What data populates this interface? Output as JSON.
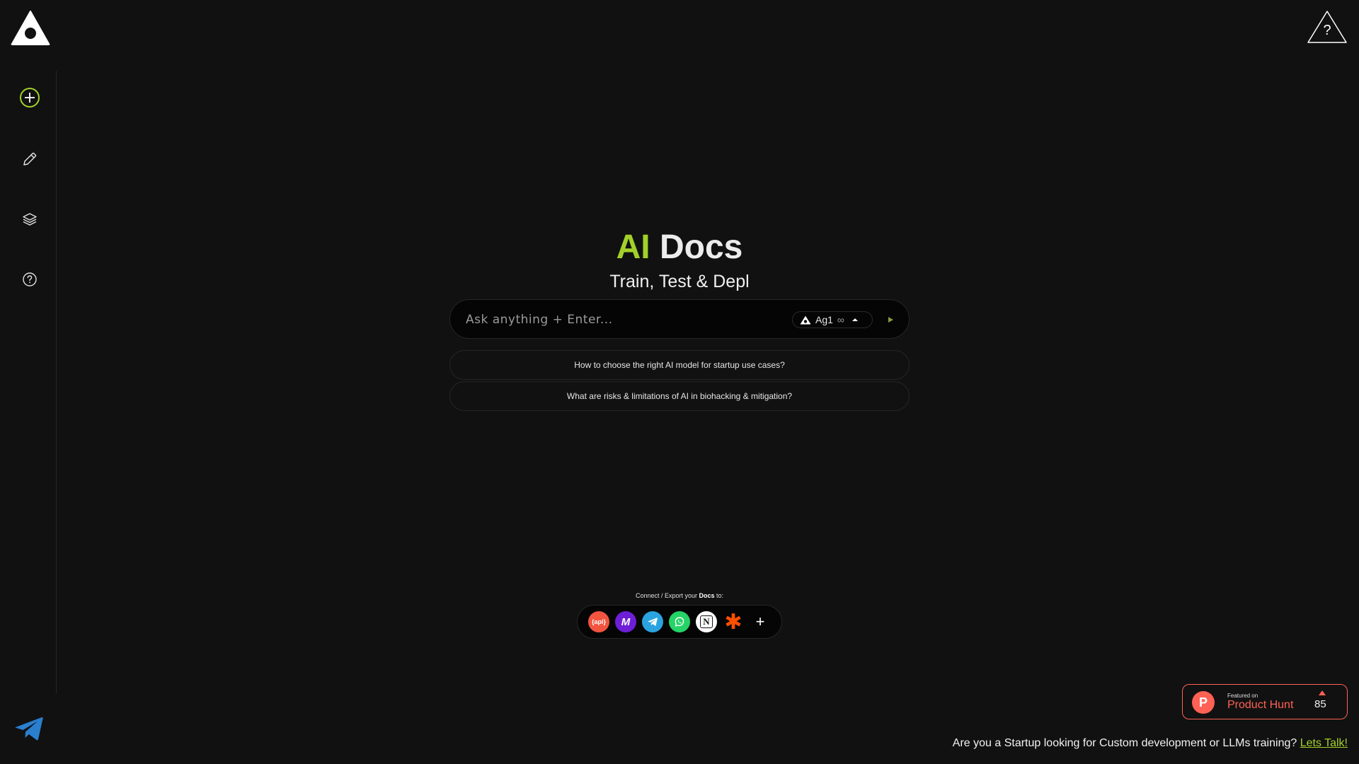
{
  "brand": {
    "accent_color": "#a3d12a",
    "logo_icon": "triangle-eye-logo"
  },
  "sidebar": {
    "items": [
      {
        "name": "new-doc",
        "icon": "plus-circle-icon"
      },
      {
        "name": "edit",
        "icon": "pencil-icon"
      },
      {
        "name": "layers",
        "icon": "layers-icon"
      },
      {
        "name": "help",
        "icon": "question-circle-icon"
      }
    ],
    "footer_icon": "telegram-icon"
  },
  "header": {
    "help_icon": "question-triangle-icon",
    "help_glyph": "?"
  },
  "hero": {
    "title_accent": "AI",
    "title_rest": "Docs",
    "subtitle": "Train, Test & Depl"
  },
  "ask": {
    "placeholder": "Ask anything + Enter...",
    "model_label": "Ag1",
    "model_suffix": "∞"
  },
  "suggestions": [
    "How to choose the right AI model for startup use cases?",
    "What are risks & limitations of AI in biohacking & mitigation?"
  ],
  "connect": {
    "label_prefix": "Connect / Export your ",
    "label_bold": "Docs",
    "label_suffix": " to:",
    "integrations": [
      {
        "name": "api",
        "label": "{api}",
        "color": "#f2543f"
      },
      {
        "name": "make",
        "label": "M",
        "color": "#6d1ed6"
      },
      {
        "name": "telegram",
        "label": "",
        "color": "#2aa3e0"
      },
      {
        "name": "whatsapp",
        "label": "",
        "color": "#25d366"
      },
      {
        "name": "notion",
        "label": "N",
        "color": "#ffffff"
      },
      {
        "name": "zapier",
        "label": "✱",
        "color": "#ff4f00"
      },
      {
        "name": "add",
        "label": "+",
        "color": "transparent"
      }
    ]
  },
  "product_hunt": {
    "featured_on": "Featured on",
    "name": "Product Hunt",
    "count": "85",
    "color": "#ff6154"
  },
  "footer": {
    "text": "Are you a Startup looking for Custom development or LLMs training? ",
    "link": "Lets Talk!"
  }
}
